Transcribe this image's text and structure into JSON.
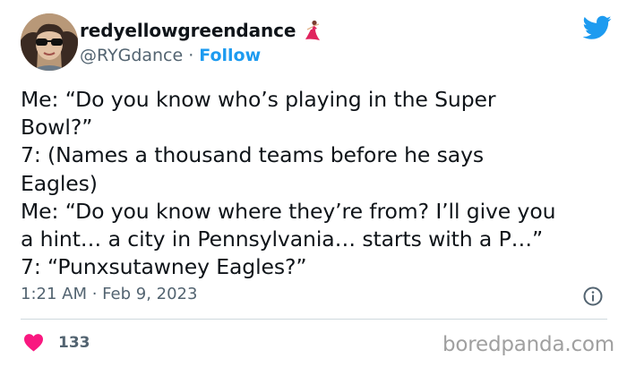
{
  "user": {
    "display_name": "redyellowgreendance",
    "name_emoji": "dancer-icon",
    "handle": "@RYGdance",
    "separator": "·",
    "follow_label": "Follow"
  },
  "tweet": {
    "text": "Me: “Do you know who’s playing in the Super\nBowl?”\n7: (Names a thousand teams before he says\nEagles)\nMe: “Do you know where they’re from? I’ll give you\na hint… a city in Pennsylvania… starts with a P…”\n7: “Punxsutawney Eagles?”",
    "timestamp": "1:21 AM · Feb 9, 2023",
    "like_count": "133"
  },
  "watermark": "boredpanda.com",
  "colors": {
    "accent": "#1d9bf0",
    "heart": "#f91880",
    "muted_text": "#536471"
  },
  "icons": [
    "twitter-bird-icon",
    "info-icon",
    "heart-icon",
    "dancer-icon"
  ]
}
